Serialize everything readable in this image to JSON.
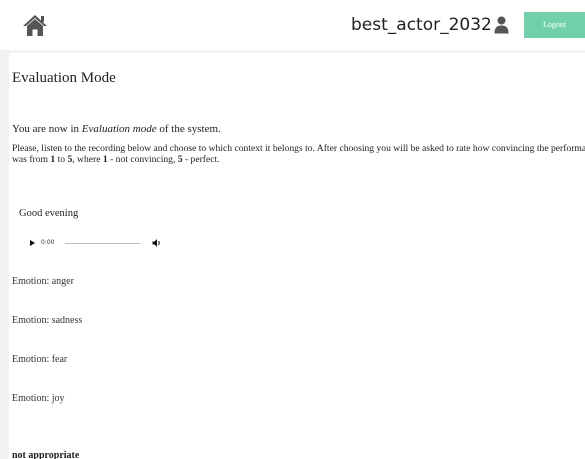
{
  "header": {
    "username": "best_actor_2032",
    "logout_label": "Logout",
    "home_icon": "home-icon",
    "user_icon": "user-icon",
    "accent_color": "#71d0aa"
  },
  "main": {
    "title": "Evaluation Mode",
    "intro": {
      "before": "You are now in ",
      "mode": "Evaluation mode",
      "after": " of the system."
    },
    "instructions": {
      "part1": "Please, listen to the recording below and choose to which context it belongs to. After choosing you will be asked to rate how convincing the performance was from ",
      "min": "1",
      "part2": " to ",
      "max": "5",
      "part3": ", where ",
      "low": "1",
      "part4": " - not convincing, ",
      "high": "5",
      "part5": " - perfect."
    },
    "phrase": "Good evening",
    "audio": {
      "time": "0:00",
      "play_icon": "play-icon",
      "volume_icon": "volume-icon"
    },
    "emotions": [
      "Emotion: anger",
      "Emotion: sadness",
      "Emotion: fear",
      "Emotion: joy"
    ],
    "not_appropriate": "not appropriate"
  }
}
